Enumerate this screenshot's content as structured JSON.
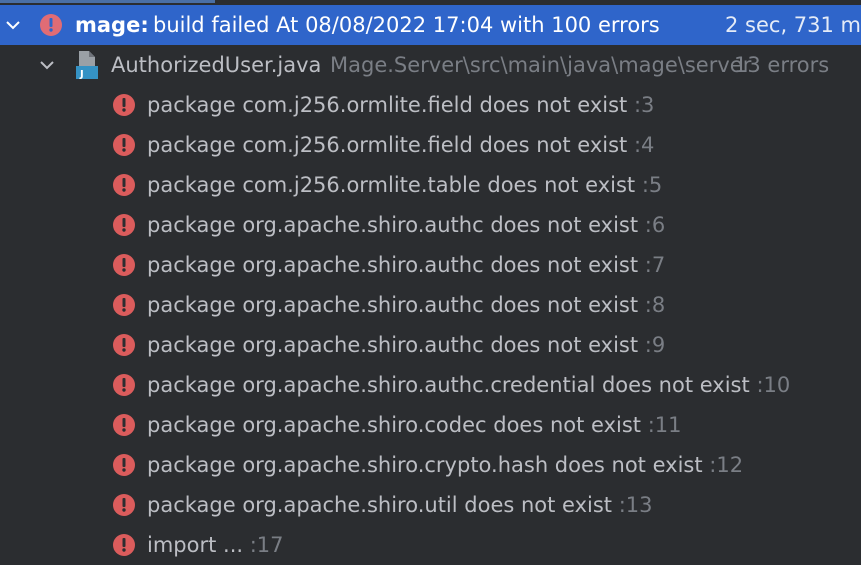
{
  "root": {
    "module": "mage:",
    "message": "build failed At 08/08/2022 17:04 with 100 errors",
    "duration": "2 sec, 731 ms"
  },
  "file": {
    "name": "AuthorizedUser.java",
    "path": "Mage.Server\\src\\main\\java\\mage\\server",
    "count": "13 errors"
  },
  "errors": [
    {
      "msg": "package com.j256.ormlite.field does not exist",
      "line": ":3"
    },
    {
      "msg": "package com.j256.ormlite.field does not exist",
      "line": ":4"
    },
    {
      "msg": "package com.j256.ormlite.table does not exist",
      "line": ":5"
    },
    {
      "msg": "package org.apache.shiro.authc does not exist",
      "line": ":6"
    },
    {
      "msg": "package org.apache.shiro.authc does not exist",
      "line": ":7"
    },
    {
      "msg": "package org.apache.shiro.authc does not exist",
      "line": ":8"
    },
    {
      "msg": "package org.apache.shiro.authc does not exist",
      "line": ":9"
    },
    {
      "msg": "package org.apache.shiro.authc.credential does not exist",
      "line": ":10"
    },
    {
      "msg": "package org.apache.shiro.codec does not exist",
      "line": ":11"
    },
    {
      "msg": "package org.apache.shiro.crypto.hash does not exist",
      "line": ":12"
    },
    {
      "msg": "package org.apache.shiro.util does not exist",
      "line": ":13"
    },
    {
      "msg": "import ...",
      "line": ":17"
    }
  ],
  "colors": {
    "background": "#2b2d30",
    "selection": "#2f65ca",
    "error": "#db5c5c",
    "text": "#bcbec4",
    "muted": "#7a7e85"
  },
  "icons": {
    "error": "error-circle-icon",
    "expand": "chevron-down-icon",
    "file": "java-file-icon"
  }
}
